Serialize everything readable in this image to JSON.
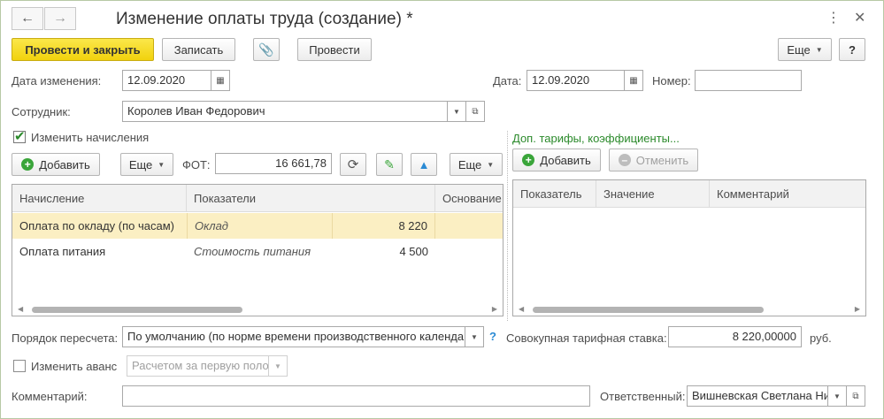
{
  "window": {
    "title": "Изменение оплаты труда (создание) *",
    "back_icon": "arrow-left-icon",
    "forward_icon": "arrow-right-icon",
    "menu_icon": "kebab-menu-icon",
    "close_icon": "close-icon"
  },
  "toolbar": {
    "post_close": "Провести и закрыть",
    "save": "Записать",
    "attach_icon": "paperclip-icon",
    "post": "Провести",
    "more": "Еще",
    "help": "?"
  },
  "form": {
    "change_date_label": "Дата изменения:",
    "change_date": "12.09.2020",
    "date_label": "Дата:",
    "date": "12.09.2020",
    "number_label": "Номер:",
    "number": "",
    "employee_label": "Сотрудник:",
    "employee": "Королев Иван Федорович",
    "change_accruals_label": "Изменить начисления",
    "change_accruals_checked": true
  },
  "accruals": {
    "add": "Добавить",
    "more": "Еще",
    "more2": "Еще",
    "fot_label": "ФОТ:",
    "fot_value": "16 661,78",
    "columns": [
      "Начисление",
      "Показатели",
      "",
      "Основание"
    ],
    "rows": [
      {
        "name": "Оплата по окладу (по часам)",
        "indicator": "Оклад",
        "value": "8 220",
        "basis": ""
      },
      {
        "name": "Оплата питания",
        "indicator": "Стоимость питания",
        "value": "4 500",
        "basis": ""
      }
    ]
  },
  "tariffs": {
    "link": "Доп. тарифы, коэффициенты...",
    "add": "Добавить",
    "cancel": "Отменить",
    "columns": [
      "Показатель",
      "Значение",
      "Комментарий"
    ]
  },
  "bottom": {
    "recalc_label": "Порядок пересчета:",
    "recalc_value": "По умолчанию (по норме времени производственного календаря)",
    "help": "?",
    "total_rate_label": "Совокупная тарифная ставка:",
    "total_rate_value": "8 220,00000",
    "total_rate_unit": "руб.",
    "change_advance_label": "Изменить аванс",
    "change_advance_checked": false,
    "advance_value": "Расчетом за первую половину месяца",
    "comment_label": "Комментарий:",
    "comment_value": "",
    "responsible_label": "Ответственный:",
    "responsible_value": "Вишневская Светлана Николаевна"
  },
  "colors": {
    "primary_button": "#f5d81c",
    "selected_row": "#fbefc3",
    "link": "#2b8a2b",
    "add_icon": "#3aa53a",
    "refresh_icon": "#555555",
    "edit_icon": "#3aa53a",
    "up_icon": "#2a8ad4"
  }
}
